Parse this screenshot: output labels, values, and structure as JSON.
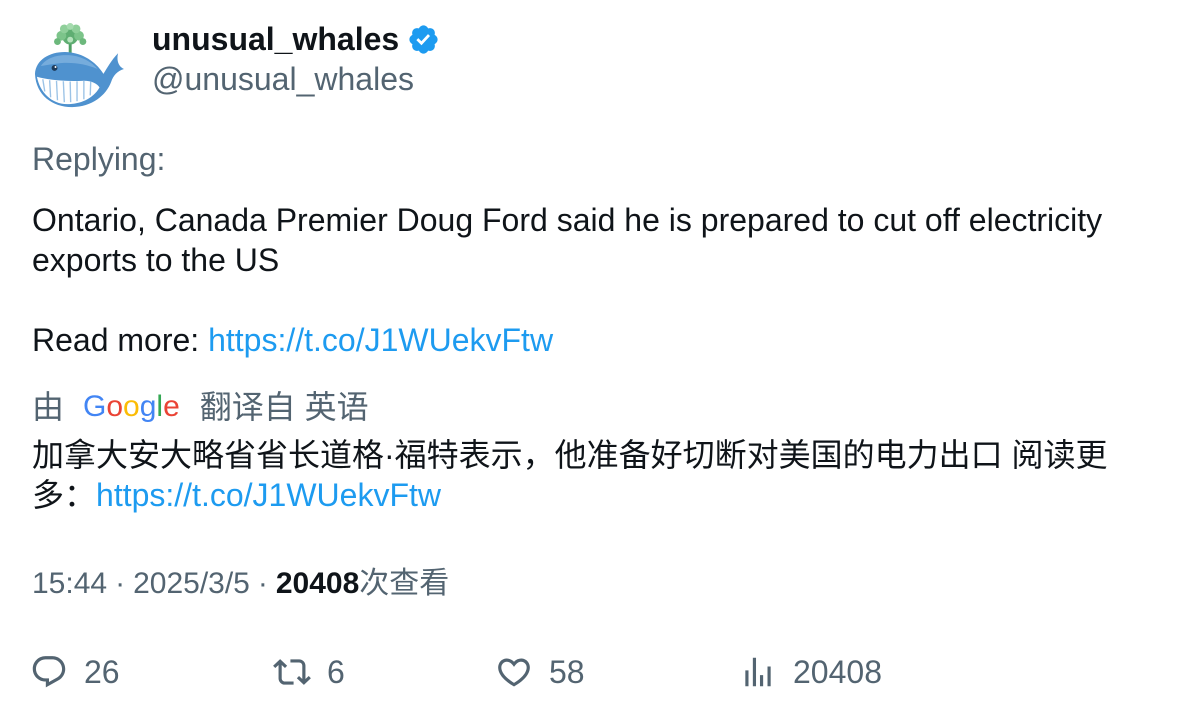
{
  "author": {
    "name": "unusual_whales",
    "handle": "@unusual_whales",
    "verified": true
  },
  "reply_label": "Replying:",
  "tweet": {
    "text": "Ontario, Canada Premier Doug Ford said he is prepared to cut off electricity exports to the US",
    "read_more_label": "Read more: ",
    "link": "https://t.co/J1WUekvFtw"
  },
  "translation": {
    "prefix": "由",
    "provider_logo": "Google",
    "provider_logo_colors": [
      "#4285F4",
      "#EA4335",
      "#FBBC05",
      "#4285F4",
      "#34A853",
      "#EA4335"
    ],
    "suffix": "翻译自 英语",
    "text": "加拿大安大略省省长道格·福特表示，他准备好切断对美国的电力出口 阅读更多：",
    "link": "https://t.co/J1WUekvFtw"
  },
  "meta": {
    "time": "15:44",
    "separator": "·",
    "date": "2025/3/5",
    "views": "20408",
    "views_label": "次查看"
  },
  "actions": {
    "replies": "26",
    "retweets": "6",
    "likes": "58",
    "views": "20408"
  },
  "icons": {
    "avatar": "whale-avatar",
    "verified": "verified-badge-icon",
    "reply": "reply-icon",
    "retweet": "retweet-icon",
    "like": "heart-icon",
    "views": "analytics-icon"
  },
  "colors": {
    "text": "#0f1419",
    "secondary": "#536471",
    "link": "#1d9bf0",
    "verified": "#1d9bf0"
  }
}
